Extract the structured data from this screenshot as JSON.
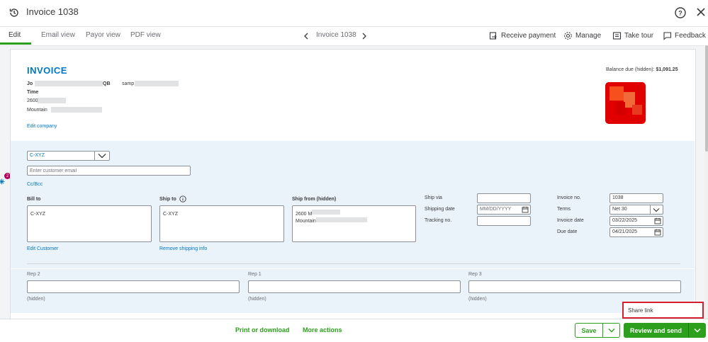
{
  "header": {
    "title": "Invoice 1038"
  },
  "tabs": [
    {
      "label": "Edit"
    },
    {
      "label": "Email view"
    },
    {
      "label": "Payor view"
    },
    {
      "label": "PDF view"
    }
  ],
  "nav": {
    "label": "Invoice 1038"
  },
  "actions": {
    "receive_payment": "Receive payment",
    "manage": "Manage",
    "take_tour": "Take tour",
    "feedback": "Feedback"
  },
  "invoice": {
    "title": "INVOICE",
    "balance_due_label": "Balance due (hidden):",
    "balance_due_value": "$1,091.25",
    "company_line1a": "Jo",
    "company_line1b": "QB",
    "company_line1c": "samp",
    "company_line2": "Time",
    "company_line3": "2600",
    "company_line4": "Mountain",
    "edit_company": "Edit company"
  },
  "customer": {
    "selected": "C-XYZ",
    "email_placeholder": "Enter customer email",
    "cc_bcc": "Cc/Bcc",
    "bill_to_label": "Bill to",
    "bill_to_value": "C-XYZ",
    "ship_to_label": "Ship to",
    "ship_to_value": "C-XYZ",
    "ship_from_label": "Ship from (hidden)",
    "ship_from_line1": "2600 M",
    "ship_from_line2": "Mountain",
    "edit_customer": "Edit Customer",
    "remove_shipping": "Remove shipping info"
  },
  "shipping": {
    "ship_via_label": "Ship via",
    "shipping_date_label": "Shipping date",
    "shipping_date_placeholder": "MM/DD/YYYY",
    "tracking_label": "Tracking no."
  },
  "details": {
    "invoice_no_label": "Invoice no.",
    "invoice_no_value": "1038",
    "terms_label": "Terms",
    "terms_value": "Net 30",
    "invoice_date_label": "Invoice date",
    "invoice_date_value": "03/22/2025",
    "due_date_label": "Due date",
    "due_date_value": "04/21/2025"
  },
  "reps": [
    {
      "label": "Rep 2",
      "hint": "(hidden)"
    },
    {
      "label": "Rep 1",
      "hint": "(hidden)"
    },
    {
      "label": "Rep 3",
      "hint": "(hidden)"
    }
  ],
  "footer": {
    "print_download": "Print or download",
    "more_actions": "More actions",
    "save": "Save",
    "review_send": "Review and send",
    "share_link": "Share link"
  },
  "side": {
    "badge": "2"
  },
  "colors": {
    "brand_green": "#2ca01c",
    "link_blue": "#0077c5",
    "highlight_red": "#d81e2c"
  }
}
